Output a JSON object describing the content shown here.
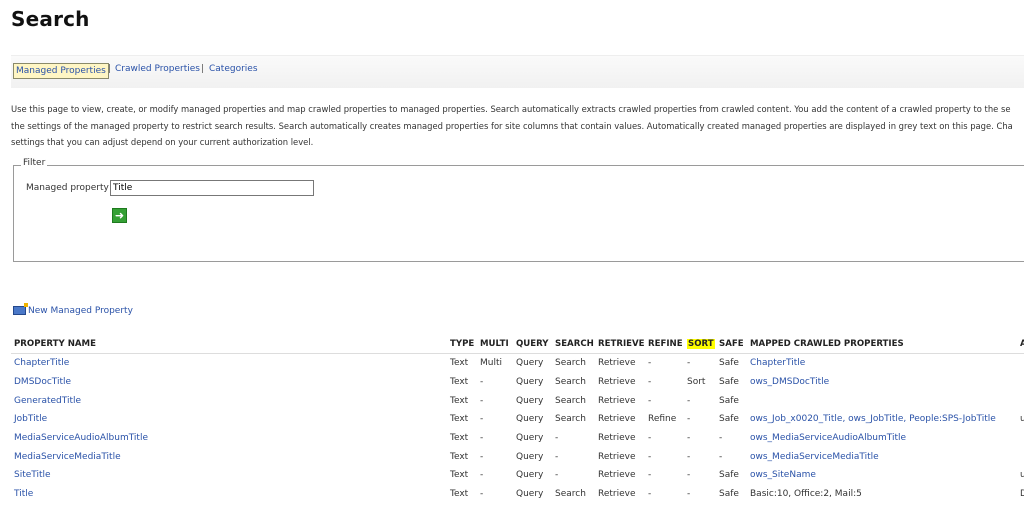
{
  "page_title": "Search",
  "tabs": {
    "managed": "Managed Properties",
    "sep1": "|",
    "crawled": "Crawled Properties",
    "sep2": "|",
    "categories": "Categories"
  },
  "description": {
    "line1": "Use this page to view, create, or modify managed properties and map crawled properties to managed properties. Search automatically extracts crawled properties from crawled content. You add the content of a crawled property to the se",
    "line2": "the settings of the managed property to restrict search results. Search automatically creates managed properties for site columns that contain values. Automatically created managed properties are displayed in grey text on this page. Cha",
    "line3": "settings that you can adjust depend on your current authorization level."
  },
  "filter": {
    "legend": "Filter",
    "label": "Managed property",
    "value": "Title",
    "go_icon": "arrow-right-icon"
  },
  "new_property": "New Managed Property",
  "table": {
    "headers": [
      "PROPERTY NAME",
      "TYPE",
      "MULTI",
      "QUERY",
      "SEARCH",
      "RETRIEVE",
      "REFINE",
      "SORT",
      "SAFE",
      "MAPPED CRAWLED PROPERTIES",
      "A"
    ],
    "rows": [
      [
        "ChapterTitle",
        "Text",
        "Multi",
        "Query",
        "Search",
        "Retrieve",
        "-",
        "-",
        "Safe",
        "ChapterTitle",
        ""
      ],
      [
        "DMSDocTitle",
        "Text",
        "-",
        "Query",
        "Search",
        "Retrieve",
        "-",
        "Sort",
        "Safe",
        "ows_DMSDocTitle",
        ""
      ],
      [
        "GeneratedTitle",
        "Text",
        "-",
        "Query",
        "Search",
        "Retrieve",
        "-",
        "-",
        "Safe",
        "",
        ""
      ],
      [
        "JobTitle",
        "Text",
        "-",
        "Query",
        "Search",
        "Retrieve",
        "Refine",
        "-",
        "Safe",
        "ows_Job_x0020_Title, ows_JobTitle, People:SPS-JobTitle",
        "u"
      ],
      [
        "MediaServiceAudioAlbumTitle",
        "Text",
        "-",
        "Query",
        "-",
        "Retrieve",
        "-",
        "-",
        "-",
        "ows_MediaServiceAudioAlbumTitle",
        ""
      ],
      [
        "MediaServiceMediaTitle",
        "Text",
        "-",
        "Query",
        "-",
        "Retrieve",
        "-",
        "-",
        "-",
        "ows_MediaServiceMediaTitle",
        ""
      ],
      [
        "SiteTitle",
        "Text",
        "-",
        "Query",
        "-",
        "Retrieve",
        "-",
        "-",
        "Safe",
        "ows_SiteName",
        "u"
      ],
      [
        "Title",
        "Text",
        "-",
        "Query",
        "Search",
        "Retrieve",
        "-",
        "-",
        "Safe",
        "Basic:10, Office:2, Mail:5",
        "D"
      ]
    ]
  },
  "colors": {
    "link": "#2a52a8",
    "highlight": "#ffff00"
  }
}
